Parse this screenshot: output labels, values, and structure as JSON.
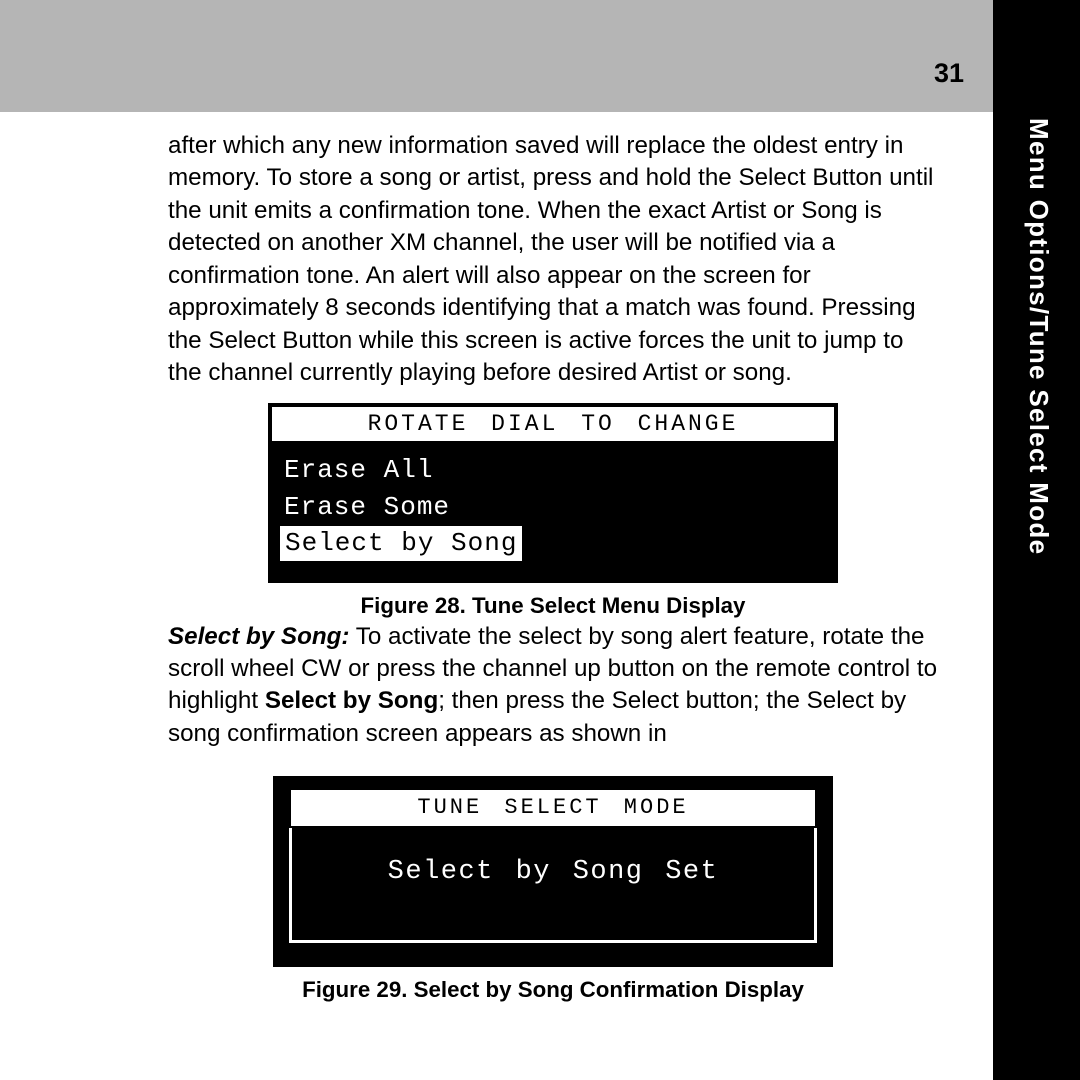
{
  "page_number": "31",
  "sidebar_title": "Menu Options/Tune Select Mode",
  "para1": "after which any new information saved will replace the oldest entry in memory. To store a song or artist, press and hold the Select Button until the unit emits a confirmation tone. When the exact Artist or Song is detected on another XM channel, the user will be notified via a confirmation tone.  An alert will also appear on the screen for approximately 8 seconds identifying that a match was found. Pressing the Select Button while this screen is active forces the unit to jump to the channel currently playing before desired Artist or song.",
  "fig28": {
    "header": "ROTATE DIAL TO CHANGE",
    "rows": [
      "Erase All",
      "Erase Some",
      "Select by Song"
    ],
    "caption": "Figure 28. Tune Select Menu Display"
  },
  "para2": {
    "lead": "Select by Song:",
    "before_bold": " To activate the select by song alert feature, rotate the scroll wheel CW or press the channel up button on the remote control to highlight ",
    "bold": "Select by Song",
    "after_bold": "; then press the Select button; the Select by song confirmation screen appears as shown in"
  },
  "fig29": {
    "header": "TUNE SELECT MODE",
    "body": "Select by Song Set",
    "caption": "Figure 29. Select by Song Confirmation Display"
  }
}
